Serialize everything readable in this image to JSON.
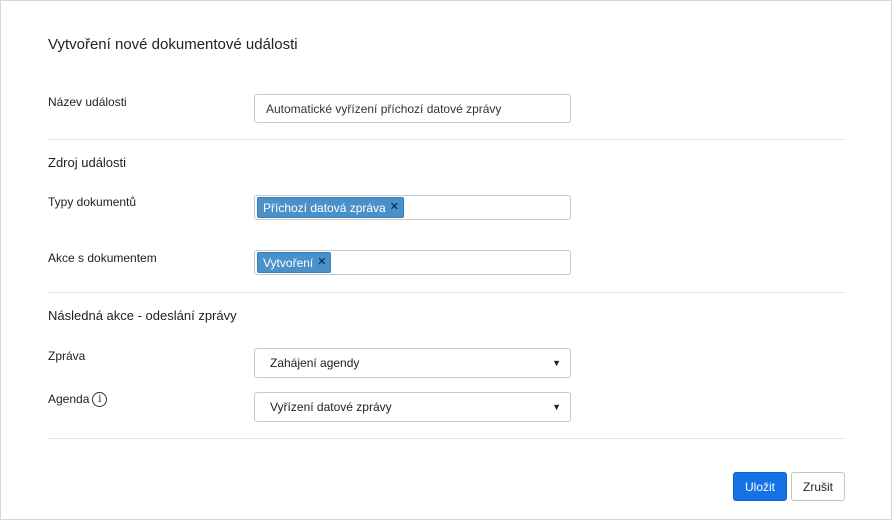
{
  "dialog": {
    "title": "Vytvoření nové dokumentové události"
  },
  "event_name": {
    "label": "Název události",
    "value": "Automatické vyřízení příchozí datové zprávy"
  },
  "source_section": {
    "title": "Zdroj události",
    "document_types": {
      "label": "Typy dokumentů",
      "tags": [
        "Příchozí datová zpráva"
      ]
    },
    "document_actions": {
      "label": "Akce s dokumentem",
      "tags": [
        "Vytvoření"
      ]
    }
  },
  "followup_section": {
    "title": "Následná akce - odeslání zprávy",
    "message": {
      "label": "Zpráva",
      "selected": "Zahájení agendy"
    },
    "agenda": {
      "label": "Agenda",
      "info_glyph": "i",
      "selected": "Vyřízení datové zprávy"
    }
  },
  "icons": {
    "tag_remove": "close-icon",
    "dropdown": "caret-down-icon",
    "info": "info-icon"
  },
  "colors": {
    "primary": "#1472e6",
    "tag": "#4a90c9"
  },
  "footer": {
    "save_label": "Uložit",
    "cancel_label": "Zrušit"
  }
}
